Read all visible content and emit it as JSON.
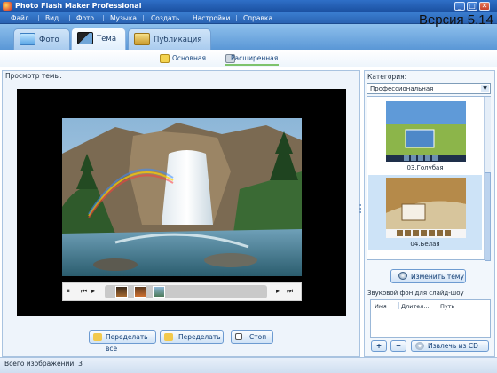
{
  "window": {
    "title": "Photo Flash Maker Professional"
  },
  "menu": [
    "Файл",
    "Вид",
    "Фото",
    "Музыка",
    "Создать",
    "Настройки",
    "Справка"
  ],
  "tabs": [
    {
      "label": "Фото",
      "icon": "photo-icon"
    },
    {
      "label": "Тема",
      "icon": "theme-film-icon",
      "active": true
    },
    {
      "label": "Публикация",
      "icon": "publish-icon"
    }
  ],
  "version_label": "Версия 5.14",
  "subtabs": {
    "basic": "Основная",
    "advanced": "Расширенная"
  },
  "preview": {
    "label": "Просмотр темы:"
  },
  "player": {
    "pause": "⏸",
    "prev": "⏮",
    "next": "⏭",
    "last": "⏭"
  },
  "actions": {
    "redo_all": "Переделать все",
    "redo": "Переделать",
    "stop": "Стоп"
  },
  "category": {
    "label": "Категория:",
    "selected": "Профессиональная",
    "themes": [
      {
        "name": "03.Голубая"
      },
      {
        "name": "04.Белая"
      }
    ]
  },
  "change_theme_button": "Изменить тему",
  "sound": {
    "label": "Звуковой фон для слайд-шоу",
    "columns": [
      "Имя",
      "Длител...",
      "Путь"
    ],
    "add": "+",
    "remove": "−",
    "extract": "Извлечь из CD"
  },
  "status": "Всего изображений: 3",
  "colors": {
    "accent": "#2a63b2",
    "tab_bg": "#8ec0ec",
    "selection": "#cde3f7"
  }
}
